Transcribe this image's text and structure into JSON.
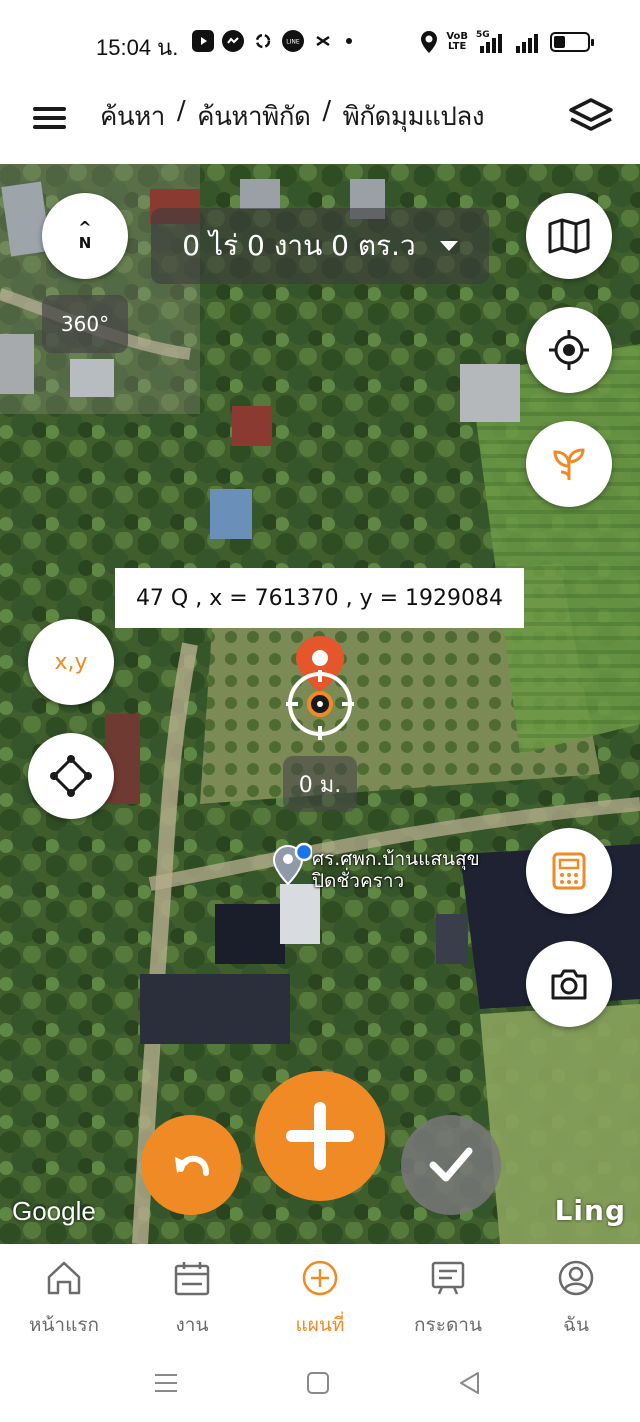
{
  "status_bar": {
    "time": "15:04 น.",
    "network_top": "VoB",
    "network_bottom": "LTE",
    "signal_label": "5G",
    "battery_level": 0.35
  },
  "header": {
    "breadcrumb": [
      "ค้นหา",
      "/",
      "ค้นหาพิกัด",
      "/",
      "พิกัดมุมแปลง"
    ]
  },
  "map": {
    "compass_letter": "N",
    "rotation_label": "360°",
    "area_label": "0 ไร่ 0 งาน 0 ตร.ว",
    "coordinate_label": "47 Q , x = 761370 , y = 1929084",
    "distance_label": "0 ม.",
    "poi_name": "ศร.ศพก.บ้านแสนสุข",
    "poi_status": "ปิดชั่วคราว",
    "xy_button": "x,y",
    "google_attribution": "Google",
    "brand_watermark": "Ling"
  },
  "icons": {
    "menu": "hamburger-icon",
    "layers": "layers-icon",
    "map_type": "map-icon",
    "locate": "crosshair-icon",
    "plant": "sprout-icon",
    "polygon": "polygon-icon",
    "calculator": "calculator-icon",
    "camera": "camera-icon",
    "undo": "undo-icon",
    "add": "plus-icon",
    "confirm": "check-icon"
  },
  "bottom_nav": [
    {
      "label": "หน้าแรก",
      "icon": "home-icon",
      "active": false
    },
    {
      "label": "งาน",
      "icon": "calendar-icon",
      "active": false
    },
    {
      "label": "แผนที่",
      "icon": "plus-circle-icon",
      "active": true
    },
    {
      "label": "กระดาน",
      "icon": "board-icon",
      "active": false
    },
    {
      "label": "ฉัน",
      "icon": "user-icon",
      "active": false
    }
  ],
  "colors": {
    "accent": "#f08a24",
    "inactive": "#6b6b6b",
    "marker": "#e5562a"
  }
}
